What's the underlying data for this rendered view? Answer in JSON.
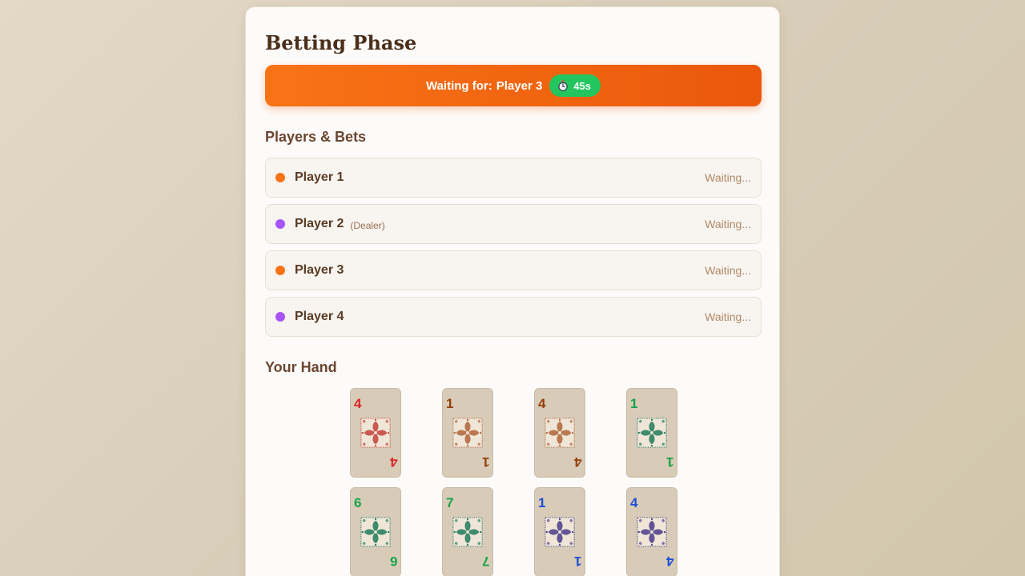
{
  "phase": {
    "title": "Betting Phase"
  },
  "turn": {
    "label": "Waiting for:",
    "player": "Player 3",
    "timer": "45s",
    "timer_icon": "stopwatch-icon",
    "colors": {
      "banner": "#f97316",
      "timer": "#22c55e"
    }
  },
  "players_section": {
    "title": "Players & Bets"
  },
  "players": [
    {
      "name": "Player 1",
      "tag": "",
      "status": "Waiting...",
      "color": "#f97316"
    },
    {
      "name": "Player 2",
      "tag": "(Dealer)",
      "status": "Waiting...",
      "color": "#a855f7"
    },
    {
      "name": "Player 3",
      "tag": "",
      "status": "Waiting...",
      "color": "#f97316"
    },
    {
      "name": "Player 4",
      "tag": "",
      "status": "Waiting...",
      "color": "#a855f7"
    }
  ],
  "hand_section": {
    "title": "Your Hand"
  },
  "hand": [
    {
      "rank": "4",
      "color": "#dc2626",
      "tile": "#c2413a"
    },
    {
      "rank": "1",
      "color": "#92400e",
      "tile": "#b0643a"
    },
    {
      "rank": "4",
      "color": "#92400e",
      "tile": "#b0643a"
    },
    {
      "rank": "1",
      "color": "#16a34a",
      "tile": "#1f7a5c"
    },
    {
      "rank": "6",
      "color": "#16a34a",
      "tile": "#1f7a5c"
    },
    {
      "rank": "7",
      "color": "#16a34a",
      "tile": "#1f7a5c"
    },
    {
      "rank": "1",
      "color": "#1d4ed8",
      "tile": "#4b3a8a"
    },
    {
      "rank": "4",
      "color": "#1d4ed8",
      "tile": "#4b3a8a"
    }
  ]
}
